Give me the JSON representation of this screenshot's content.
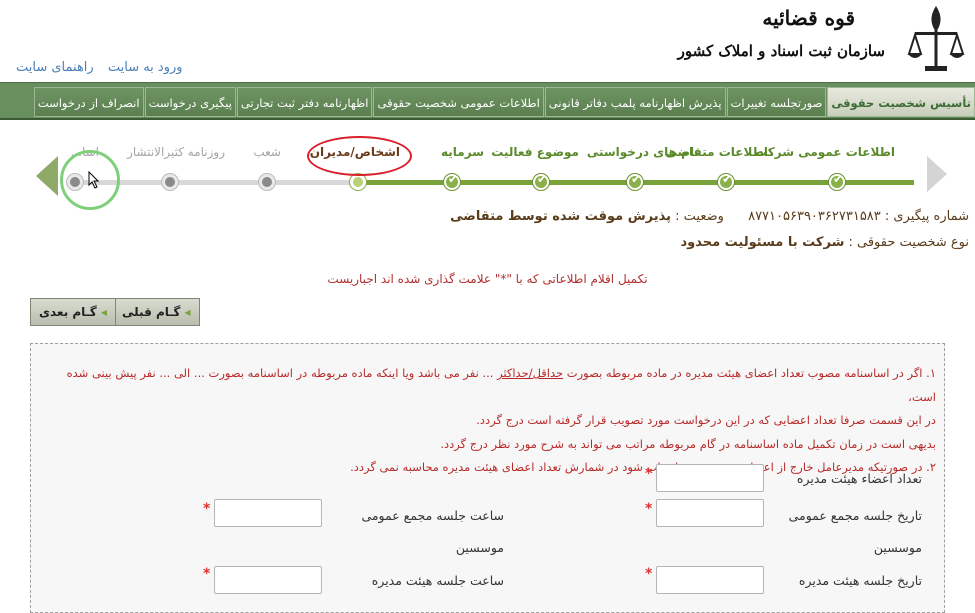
{
  "header": {
    "org_title": "قوه قضائیه",
    "org_subtitle": "سازمان ثبت اسناد و املاک کشور",
    "link_login": "ورود به سایت",
    "link_help": "راهنمای سایت"
  },
  "nav": {
    "tabs": [
      "تأسیس شخصیت حقوقی",
      "صورتجلسه تغییرات",
      "پذیرش اظهارنامه پلمب دفاتر قانونی",
      "اطلاعات عمومی شخصیت حقوقی",
      "اظهارنامه دفتر ثبت تجارتی",
      "پیگیری درخواست",
      "انصراف از درخواست"
    ]
  },
  "wizard": {
    "steps": [
      {
        "label": "اطلاعات عمومی شرکت",
        "state": "done"
      },
      {
        "label": "اطلاعات متقاضی",
        "state": "done"
      },
      {
        "label": "نام های درخواستی",
        "state": "done"
      },
      {
        "label": "موضوع فعالیت",
        "state": "done"
      },
      {
        "label": "سرمایه",
        "state": "done"
      },
      {
        "label": "اشخاص/مدیران",
        "state": "current"
      },
      {
        "label": "شعب",
        "state": "todo"
      },
      {
        "label": "روزنامه کثیرالانتشار",
        "state": "todo"
      },
      {
        "label": "اسا...",
        "state": "todo"
      }
    ]
  },
  "info": {
    "tracking_label": "شماره پیگیری :",
    "tracking_number": "۸۷۷۱۰۵۶۳۹۰۳۶۲۷۳۱۵۸۳",
    "status_label": "وضعیت :",
    "status_value": "پذیرش موقت شده توسط متقاضی",
    "entity_type_label": "نوع شخصیت حقوقی :",
    "entity_type_value": "شرکت با مسئولیت محدود",
    "required_notice": "تکمیل اقلام اطلاعاتی که با \"*\" علامت گذاری شده اند اجباریست"
  },
  "buttons": {
    "next": "گـام بعدی",
    "prev": "گـام قبلی"
  },
  "rules": {
    "line1_a": "۱. اگر در اساسنامه مصوب تعداد اعضای هیئت مدیره در ماده مربوطه بصورت",
    "line1_u": "حداقل/حداکثر",
    "line1_b": "... نفر می باشد ویا اینکه ماده مربوطه در اساسنامه بصورت ... الی ... نفر پیش بینی شده است،",
    "line2": "در این قسمت صرفا تعداد اعضایی که در این درخواست مورد تصویب قرار گرفته است درج گردد.",
    "line3": "بدیهی است در زمان تکمیل ماده اساسنامه در گام مربوطه مراتب می تواند به شرح مورد نظر درج گردد.",
    "line4": "۲. در صورتیکه مدیرعامل خارج از اعضای هیئت مدیره انتخاب شود در شمارش تعداد اعضای هیئت مدیره محاسبه نمی گردد."
  },
  "form": {
    "board_count_label": "تعداد اعضاء هیئت مدیره",
    "general_assembly_date_label": "تاریخ جلسه مجمع عمومی",
    "general_assembly_date_sub": "موسسین",
    "general_assembly_time_label": "ساعت جلسه مجمع عمومی",
    "general_assembly_time_sub": "موسسین",
    "board_meeting_date_label": "تاریخ جلسه هیئت مدیره",
    "board_meeting_time_label": "ساعت جلسه هیئت مدیره",
    "required_mark": "*"
  }
}
